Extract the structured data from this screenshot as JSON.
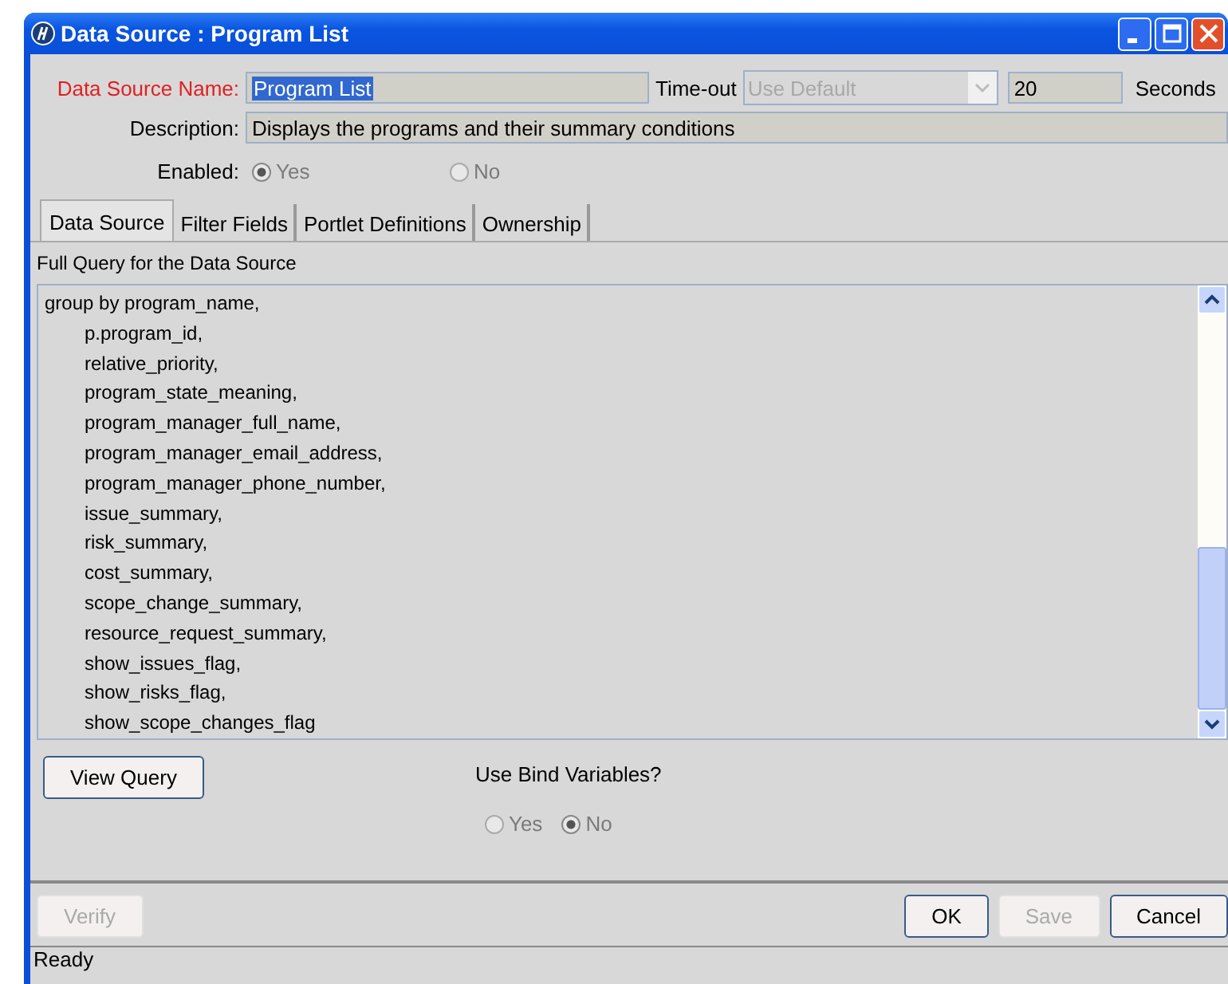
{
  "window": {
    "title": "Data Source : Program List"
  },
  "name_field": {
    "label": "Data Source Name:",
    "value": "Program List",
    "required": true
  },
  "timeout": {
    "label": "Time-out",
    "value": "Use Default",
    "disabled": true,
    "seconds_value": "20",
    "unit": "Seconds"
  },
  "description": {
    "label": "Description:",
    "value": "Displays the programs and their summary conditions"
  },
  "enabled": {
    "label": "Enabled:",
    "options": [
      {
        "label": "Yes",
        "selected": true,
        "disabled": true
      },
      {
        "label": "No",
        "selected": false,
        "disabled": true
      }
    ]
  },
  "tabs": [
    {
      "label": "Data Source",
      "selected": true
    },
    {
      "label": "Filter Fields",
      "selected": false
    },
    {
      "label": "Portlet Definitions",
      "selected": false
    },
    {
      "label": "Ownership",
      "selected": false
    }
  ],
  "query": {
    "label": "Full Query for the Data Source",
    "lines": [
      {
        "text": "group by program_name,",
        "children": [
          {
            "text": "p.program_id,"
          },
          {
            "text": "relative_priority,"
          },
          {
            "text": "program_state_meaning,"
          },
          {
            "text": "program_manager_full_name,"
          },
          {
            "text": "program_manager_email_address,"
          },
          {
            "text": "program_manager_phone_number,"
          },
          {
            "text": "issue_summary,"
          },
          {
            "text": "risk_summary,"
          },
          {
            "text": "cost_summary,"
          },
          {
            "text": "scope_change_summary,"
          },
          {
            "text": "resource_request_summary,"
          },
          {
            "text": "show_issues_flag,"
          },
          {
            "text": "show_risks_flag,"
          },
          {
            "text": "show_scope_changes_flag"
          }
        ]
      }
    ]
  },
  "view_query_button": {
    "label": "View Query",
    "disabled": false
  },
  "bind_variables": {
    "label": "Use Bind Variables?",
    "options": [
      {
        "label": "Yes",
        "selected": false,
        "disabled": true
      },
      {
        "label": "No",
        "selected": true,
        "disabled": true
      }
    ]
  },
  "left_buttons": [
    {
      "label": "Verify",
      "disabled": true
    }
  ],
  "right_buttons": [
    {
      "label": "OK",
      "disabled": false
    },
    {
      "label": "Save",
      "disabled": true
    },
    {
      "label": "Cancel",
      "disabled": false
    }
  ],
  "status_bar": {
    "text": "Ready"
  }
}
